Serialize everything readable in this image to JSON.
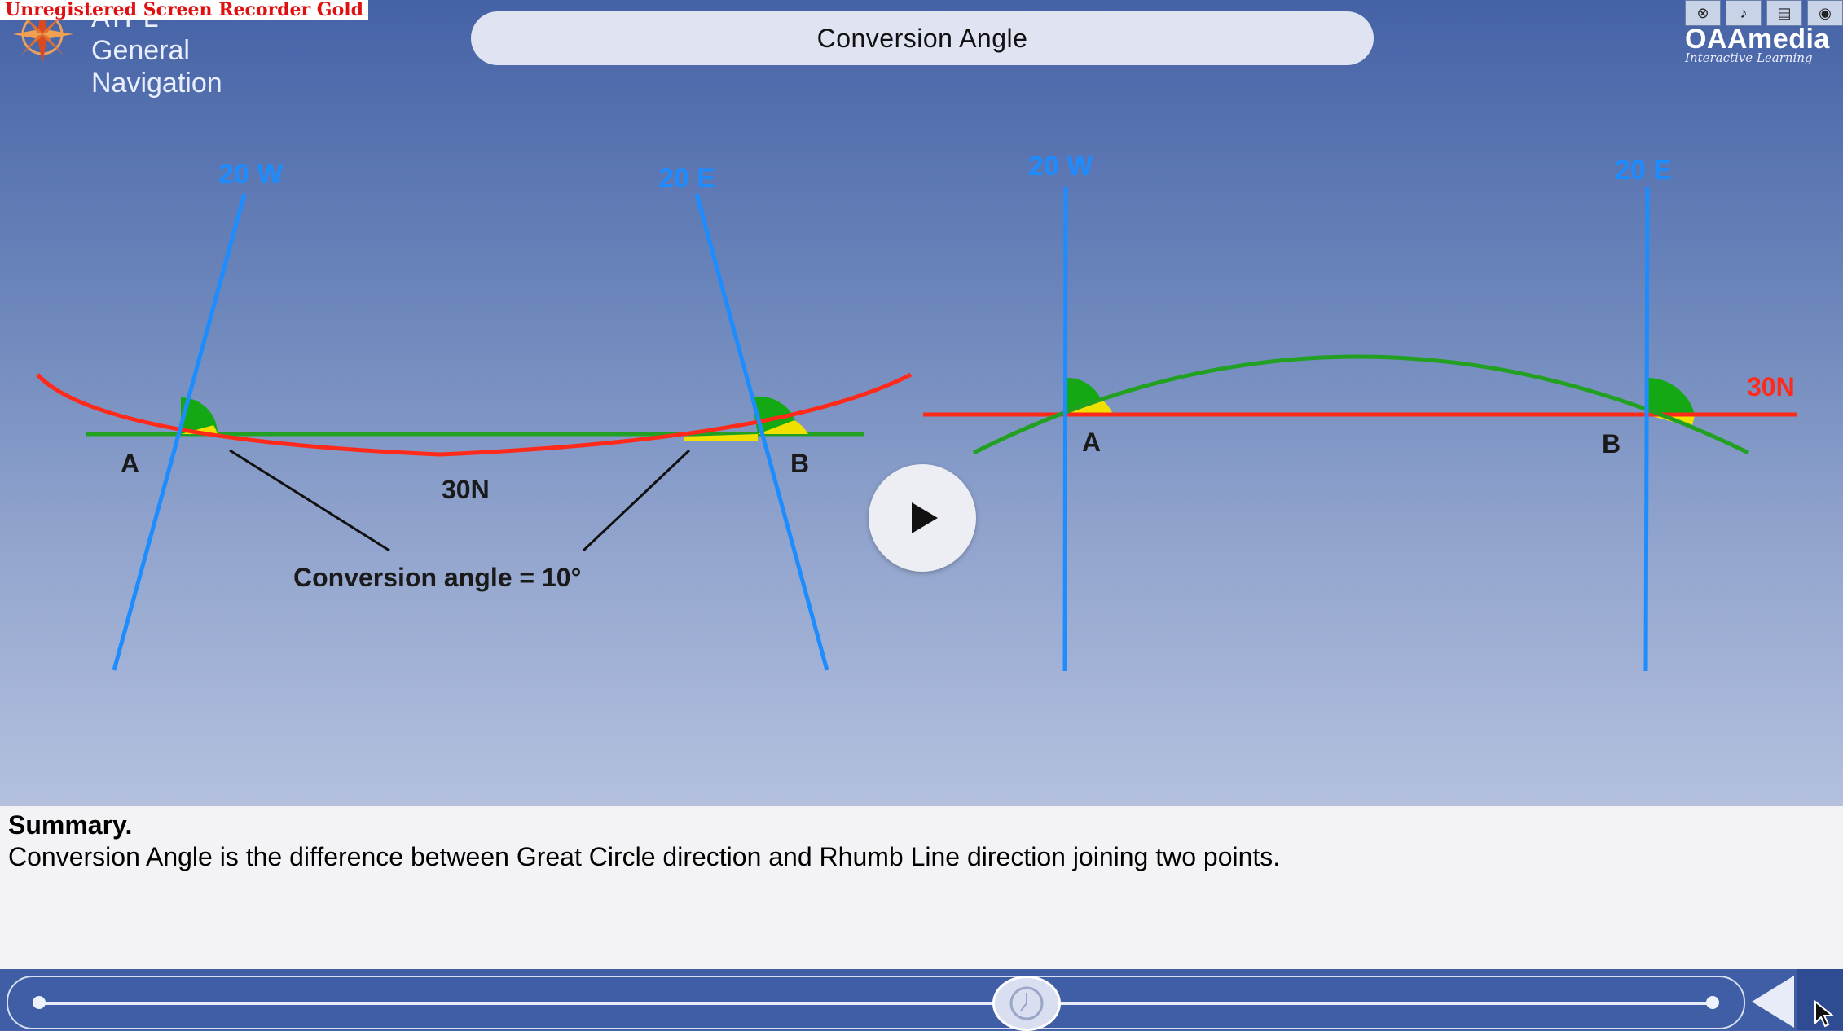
{
  "watermark": "Unregistered Screen Recorder Gold",
  "brand": {
    "line1": "ATPL General",
    "line2": "Navigation",
    "logo_icon": "compass-rose-icon"
  },
  "title": "Conversion Angle",
  "toolbar": {
    "icons": [
      "glossary-icon",
      "audio-icon",
      "book-icon",
      "eye-icon"
    ],
    "logo": "OAAmedia",
    "logo_tagline": "Interactive Learning"
  },
  "diagram": {
    "left": {
      "meridian_west": "20 W",
      "meridian_east": "20 E",
      "point_a": "A",
      "point_b": "B",
      "parallel": "30N",
      "caption": "Conversion angle = 10°"
    },
    "right": {
      "meridian_west": "20 W",
      "meridian_east": "20 E",
      "point_a": "A",
      "point_b": "B",
      "parallel": "30N"
    },
    "colors": {
      "meridian": "#1c8cff",
      "great_circle_left": "#ff2a1a",
      "rhumb_left": "#22a022",
      "rhumb_right": "#ff2a1a",
      "great_circle_right": "#22a022",
      "angle_fill": "#14a814",
      "angle_highlight": "#f0e000"
    }
  },
  "play_icon": "play-icon",
  "summary": {
    "heading": "Summary.",
    "text": "Conversion Angle is the difference between Great Circle direction and Rhumb Line direction joining two points."
  },
  "controls": {
    "scrubber_icon": "clock-icon",
    "back_icon": "back-arrow-icon",
    "cursor_icon": "mouse-cursor-icon"
  }
}
